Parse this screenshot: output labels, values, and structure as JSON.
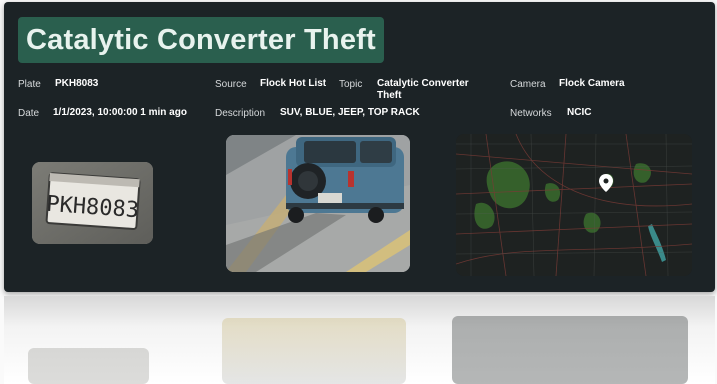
{
  "title": "Catalytic Converter Theft",
  "fields": {
    "plate_label": "Plate",
    "plate_value": "PKH8083",
    "source_label": "Source",
    "source_value": "Flock Hot List",
    "topic_label": "Topic",
    "topic_value_line1": "Catalytic Converter",
    "topic_value_line2": "Theft",
    "camera_label": "Camera",
    "camera_value": "Flock Camera",
    "date_label": "Date",
    "date_value": "1/1/2023, 10:00:00 1 min ago",
    "description_label": "Description",
    "description_value": "SUV, BLUE, JEEP, TOP RACK",
    "networks_label": "Networks",
    "networks_value": "NCIC"
  },
  "images": {
    "plate_crop_text": "PKH8083",
    "vehicle_photo": "vehicle-rear-photo",
    "map": "location-map"
  },
  "colors": {
    "card_bg": "#1c2326",
    "title_bg": "#2a5f4e",
    "title_text": "#e8f3ee",
    "label_text": "#d6d9db",
    "value_text": "#ffffff"
  }
}
